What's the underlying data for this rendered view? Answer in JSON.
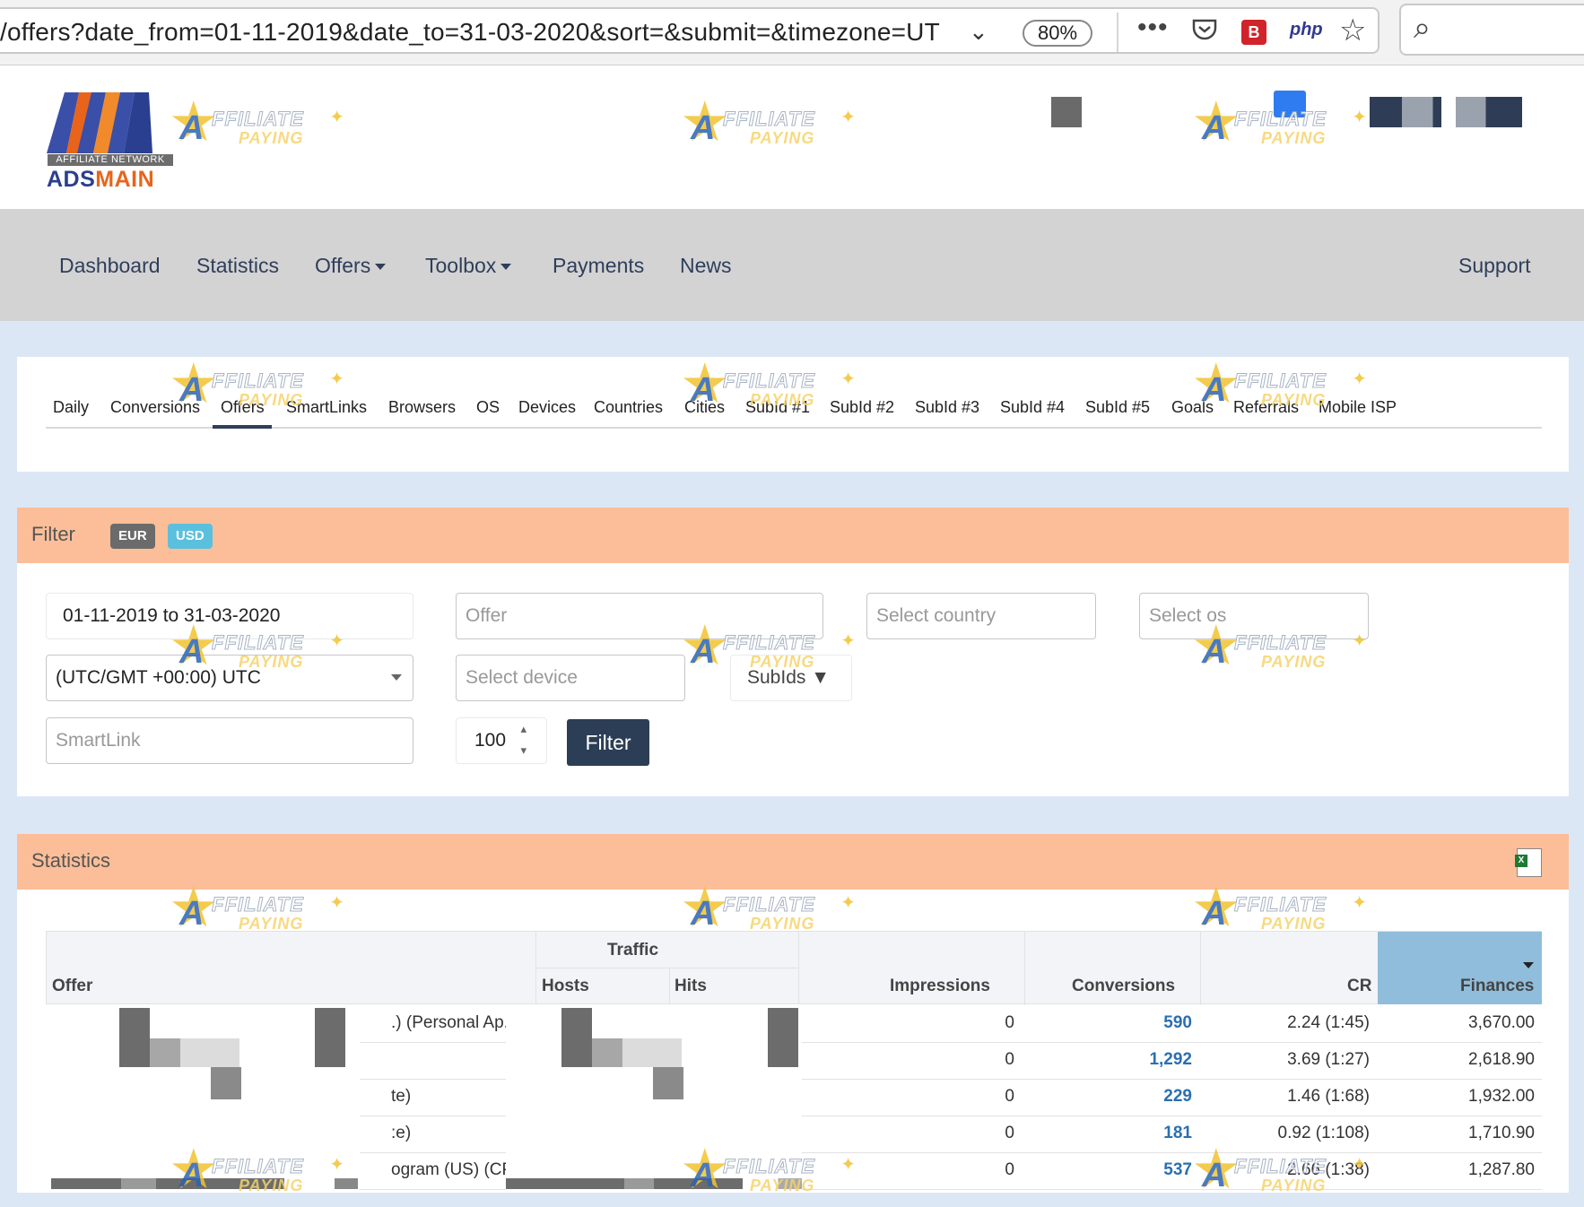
{
  "browser": {
    "url": "/offers?date_from=01-11-2019&date_to=31-03-2020&sort=&submit=&timezone=UT",
    "zoom": "80%",
    "toolbar_ext_label": "php"
  },
  "brand": {
    "subtitle": "AFFILIATE NETWORK",
    "name_part1": "ADS",
    "name_part2": "MAIN"
  },
  "watermark": {
    "word1": "FFILIATE",
    "word2": "PAYING",
    "letter": "A"
  },
  "nav": {
    "items": [
      "Dashboard",
      "Statistics",
      "Offers",
      "Toolbox",
      "Payments",
      "News"
    ],
    "support": "Support"
  },
  "tabs": [
    "Daily",
    "Conversions",
    "Offers",
    "SmartLinks",
    "Browsers",
    "OS",
    "Devices",
    "Countries",
    "Cities",
    "SubId #1",
    "SubId #2",
    "SubId #3",
    "SubId #4",
    "SubId #5",
    "Goals",
    "Referrals",
    "Mobile ISP"
  ],
  "active_tab": "Offers",
  "filter": {
    "title": "Filter",
    "currency_eur": "EUR",
    "currency_usd": "USD",
    "date_range": "01-11-2019 to 31-03-2020",
    "timezone": "(UTC/GMT +00:00) UTC",
    "smartlink_placeholder": "SmartLink",
    "offer_placeholder": "Offer",
    "device_placeholder": "Select device",
    "per_page": "100",
    "country_placeholder": "Select country",
    "os_placeholder": "Select os",
    "subids_label": "SubIds ▼",
    "submit_label": "Filter"
  },
  "colors": {
    "accent_header": "#fbbe98",
    "nav_bg": "#d3d3d3",
    "primary": "#2c3e55",
    "link": "#2b6fb1",
    "sorted_col": "#8fbddb"
  },
  "statistics": {
    "title": "Statistics",
    "group_header": "Traffic",
    "columns": {
      "offer": "Offer",
      "hosts": "Hosts",
      "hits": "Hits",
      "impressions": "Impressions",
      "conversions": "Conversions",
      "cr": "CR",
      "finances": "Finances"
    },
    "rows": [
      {
        "offer_suffix": ".) (Personal Ap...",
        "impressions": "0",
        "conversions": "590",
        "cr": "2.24 (1:45)",
        "finances": "3,670.00"
      },
      {
        "offer_suffix": "",
        "impressions": "0",
        "conversions": "1,292",
        "cr": "3.69 (1:27)",
        "finances": "2,618.90"
      },
      {
        "offer_suffix": "te)",
        "impressions": "0",
        "conversions": "229",
        "cr": "1.46 (1:68)",
        "finances": "1,932.00"
      },
      {
        "offer_suffix": ":e)",
        "impressions": "0",
        "conversions": "181",
        "cr": "0.92 (1:108)",
        "finances": "1,710.90"
      },
      {
        "offer_suffix": "ogram (US) (CP...",
        "impressions": "0",
        "conversions": "537",
        "cr": "2.66 (1:38)",
        "finances": "1,287.80"
      }
    ]
  }
}
